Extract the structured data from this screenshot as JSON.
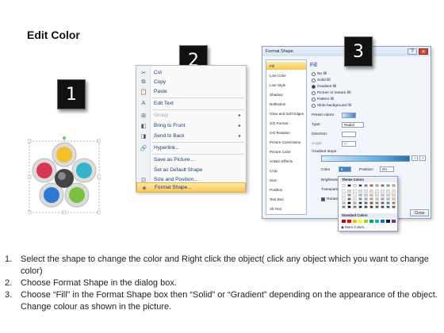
{
  "title": "Edit Color",
  "badges": [
    "1",
    "2",
    "3"
  ],
  "context_menu": {
    "items": [
      {
        "label": "Cut",
        "icon": "scissors-icon",
        "glyph": "✂"
      },
      {
        "label": "Copy",
        "icon": "copy-icon",
        "glyph": "⧉"
      },
      {
        "label": "Paste",
        "icon": "paste-icon",
        "glyph": "📋"
      },
      {
        "label": "Edit Text",
        "icon": "edit-text-icon",
        "glyph": "A"
      },
      {
        "label": "Group",
        "icon": "group-icon",
        "glyph": "⊞",
        "disabled": true,
        "submenu": true
      },
      {
        "label": "Bring to Front",
        "icon": "bring-front-icon",
        "glyph": "◧",
        "submenu": true
      },
      {
        "label": "Send to Back",
        "icon": "send-back-icon",
        "glyph": "◨",
        "submenu": true
      },
      {
        "label": "Hyperlink...",
        "icon": "hyperlink-icon",
        "glyph": "🔗"
      },
      {
        "label": "Save as Picture...",
        "icon": "",
        "glyph": ""
      },
      {
        "label": "Set as Default Shape",
        "icon": "",
        "glyph": ""
      },
      {
        "label": "Size and Position...",
        "icon": "size-position-icon",
        "glyph": "⊡"
      },
      {
        "label": "Format Shape...",
        "icon": "format-shape-icon",
        "glyph": "◈",
        "highlighted": true
      }
    ]
  },
  "dialog": {
    "title": "Format Shape",
    "categories": [
      "Fill",
      "Line Color",
      "Line Style",
      "Shadow",
      "Reflection",
      "Glow and Soft Edges",
      "3-D Format",
      "3-D Rotation",
      "Picture Corrections",
      "Picture Color",
      "Artistic Effects",
      "Crop",
      "Size",
      "Position",
      "Text Box",
      "Alt Text"
    ],
    "pane_heading": "Fill",
    "fill_options": [
      "No fill",
      "Solid fill",
      "Gradient fill",
      "Picture or texture fill",
      "Pattern fill",
      "Slide background fill"
    ],
    "selected_fill": "Gradient fill",
    "preset_colors_label": "Preset colors:",
    "type_label": "Type:",
    "type_value": "Radial",
    "direction_label": "Direction:",
    "angle_label": "Angle:",
    "angle_value": "0°",
    "gradient_stops_label": "Gradient stops",
    "color_label": "Color",
    "position_label": "Position:",
    "position_value": "0%",
    "brightness_label": "Brightness",
    "transparency_label": "Transparency",
    "rotate_label": "Rotate",
    "close_label": "Close"
  },
  "palette": {
    "theme_colors_label": "Theme Colors",
    "standard_colors_label": "Standard Colors",
    "more_colors_label": "More Colors...",
    "theme_top": [
      "#ffffff",
      "#000000",
      "#eeece1",
      "#1f497d",
      "#4f81bd",
      "#c0504d",
      "#9bbb59",
      "#8064a2",
      "#4bacc6",
      "#f79646"
    ],
    "standard": [
      "#c00000",
      "#ff0000",
      "#ffc000",
      "#ffff00",
      "#92d050",
      "#00b050",
      "#00b0f0",
      "#0070c0",
      "#002060",
      "#7030a0"
    ]
  },
  "steps": [
    {
      "n": "1.",
      "text": "Select the shape to change the color and Right click the object( click any object which you want to change color)"
    },
    {
      "n": "2.",
      "text": "Choose Format Shape in the dialog box."
    },
    {
      "n": "3.",
      "text": "Choose “Fill” in the Format Shape box then “Solid” or “Gradient” depending on the appearance of the object. Change colour as shown in the picture."
    }
  ]
}
